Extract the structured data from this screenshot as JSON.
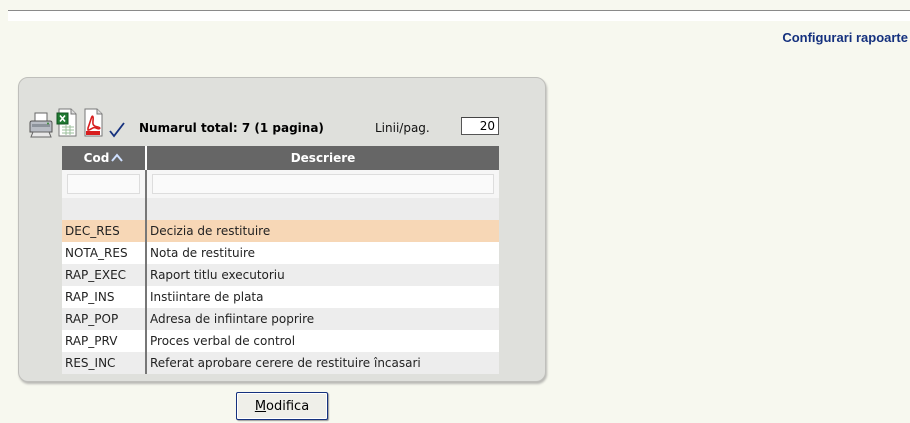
{
  "header": {
    "title": "Configurari rapoarte"
  },
  "toolbar": {
    "total_label": "Numarul total: 7 (1 pagina)",
    "lines_label": "Linii/pag.",
    "lines_value": "20"
  },
  "table": {
    "columns": [
      "Cod",
      "Descriere"
    ],
    "sort_column": "Cod",
    "sort_direction": "ascending",
    "rows": [
      {
        "code": "DEC_RES",
        "description": "Decizia de restituire",
        "selected": true
      },
      {
        "code": "NOTA_RES",
        "description": "Nota de restituire"
      },
      {
        "code": "RAP_EXEC",
        "description": "Raport titlu executoriu"
      },
      {
        "code": "RAP_INS",
        "description": "Instiintare de plata"
      },
      {
        "code": "RAP_POP",
        "description": "Adresa de infiintare poprire"
      },
      {
        "code": "RAP_PRV",
        "description": "Proces verbal de control"
      },
      {
        "code": "RES_INC",
        "description": "Referat aprobare cerere de restituire încasari"
      }
    ]
  },
  "actions": {
    "modify_first": "M",
    "modify_rest": "odifica"
  },
  "colors": {
    "title": "#15317e",
    "header_bg": "#666666",
    "selected_row": "#f7d7b6",
    "panel": "#dfe0dc"
  }
}
